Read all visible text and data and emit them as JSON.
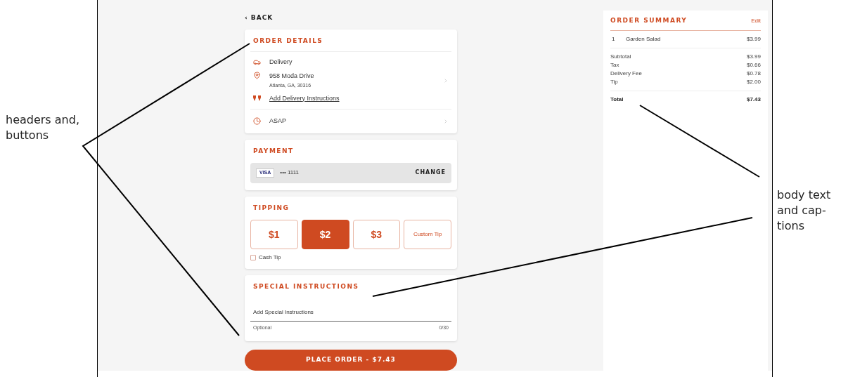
{
  "left_annotation": {
    "lines": [
      "headers and,",
      "buttons"
    ]
  },
  "right_annotation": {
    "lines": [
      "body text",
      "and cap-",
      "tions"
    ]
  },
  "back": "‹ BACK",
  "order_details": {
    "title": "ORDER DETAILS",
    "mode": "Delivery",
    "address_line_1": "958 Moda Drive",
    "address_line_2": "Atlanta, GA, 30316",
    "instructions_link": "Add Delivery Instructions",
    "time": "ASAP"
  },
  "payment": {
    "title": "PAYMENT",
    "card_brand": "VISA",
    "card_number": "••• 1111",
    "action": "CHANGE"
  },
  "tipping": {
    "title": "TIPPING",
    "options": [
      {
        "label": "$1",
        "kind": "amount",
        "selected": false
      },
      {
        "label": "$2",
        "kind": "amount",
        "selected": true
      },
      {
        "label": "$3",
        "kind": "amount",
        "selected": false
      },
      {
        "label": "Custom Tip",
        "kind": "custom",
        "selected": false
      }
    ],
    "cash_tip": {
      "label": "Cash Tip",
      "checked": false
    }
  },
  "special_instructions": {
    "title": "SPECIAL INSTRUCTIONS",
    "placeholder": "Add Special Instructions",
    "helper": "Optional",
    "counter": "0/30"
  },
  "place_order": "PLACE ORDER - $7.43",
  "summary": {
    "title": "ORDER SUMMARY",
    "edit": "Edit",
    "items": [
      {
        "qty": "1",
        "name": "Garden Salad",
        "price": "$3.99"
      }
    ],
    "lines": [
      {
        "label": "Subtotal",
        "value": "$3.99"
      },
      {
        "label": "Tax",
        "value": "$0.66"
      },
      {
        "label": "Delivery Fee",
        "value": "$0.78"
      },
      {
        "label": "Tip",
        "value": "$2.00"
      }
    ],
    "total": {
      "label": "Total",
      "value": "$7.43"
    }
  }
}
